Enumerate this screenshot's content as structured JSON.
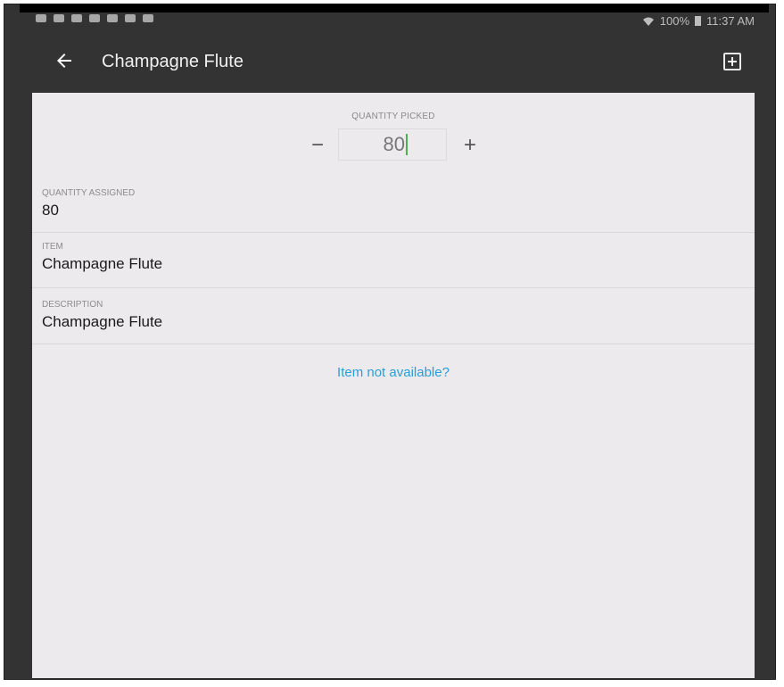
{
  "status_bar": {
    "battery_text": "100%",
    "time": "11:37 AM"
  },
  "app_bar": {
    "title": "Champagne Flute"
  },
  "quantity_picked": {
    "label": "QUANTITY PICKED",
    "value": "80",
    "minus_label": "−",
    "plus_label": "+"
  },
  "fields": [
    {
      "label": "QUANTITY ASSIGNED",
      "value": "80"
    },
    {
      "label": "ITEM",
      "value": "Champagne Flute"
    },
    {
      "label": "DESCRIPTION",
      "value": "Champagne Flute"
    }
  ],
  "link": {
    "label": "Item not available?"
  },
  "colors": {
    "app_bar": "#333333",
    "content_bg": "#eceaed",
    "link": "#2a9fd6",
    "caret": "#4caf50"
  },
  "icons": [
    "back-arrow-icon",
    "add-note-icon",
    "wifi-icon",
    "battery-icon"
  ]
}
